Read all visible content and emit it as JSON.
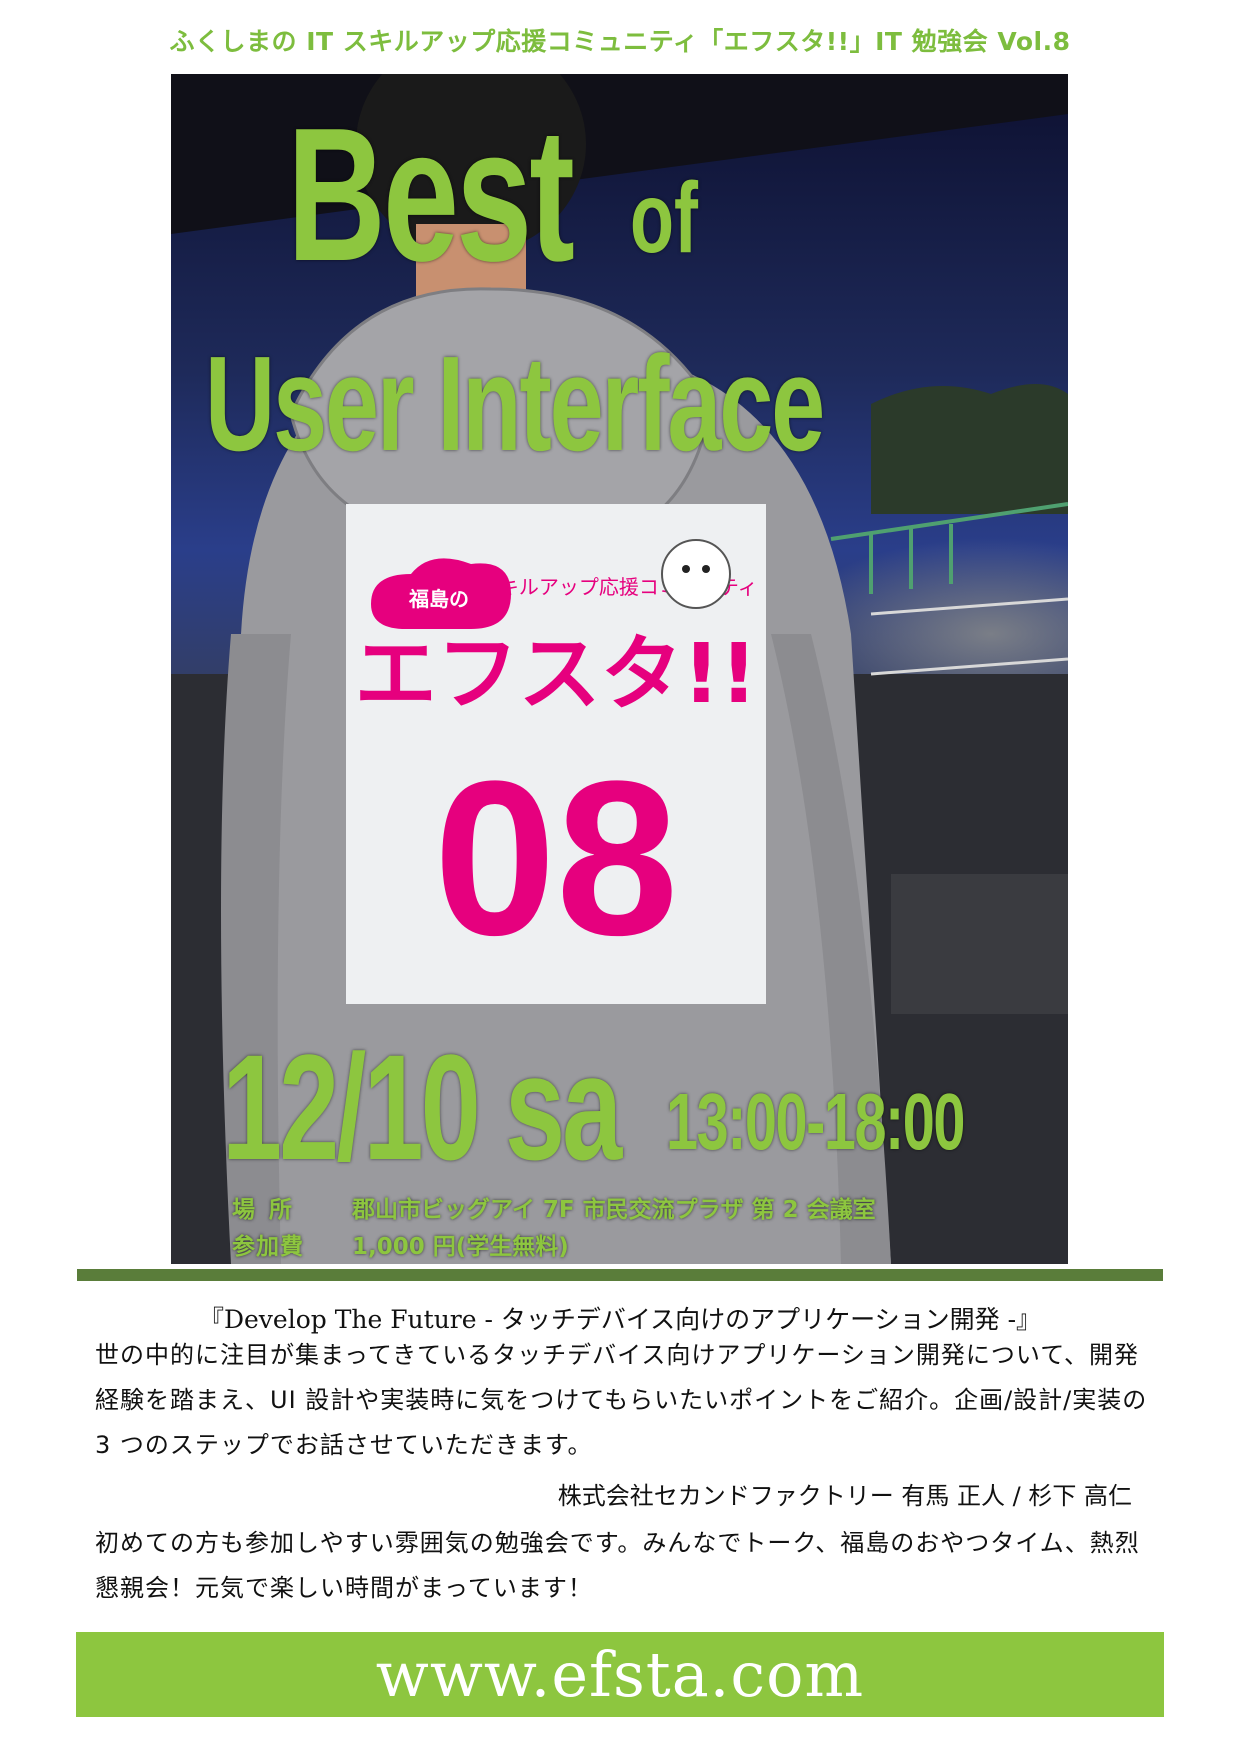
{
  "header": {
    "title": "ふくしまの IT スキルアップ応援コミュニティ「エフスタ!!」IT 勉強会 Vol.8"
  },
  "poster": {
    "headline_best": "Best",
    "headline_of": "of",
    "headline_ui": "User Interface",
    "date": "12/10 sa",
    "time": "13:00-18:00",
    "venue_label": "場所",
    "venue": "郡山市ビッグアイ 7F 市民交流プラザ 第 2 会議室",
    "fee_label": "参加費",
    "fee": "1,000 円(学生無料)"
  },
  "bib": {
    "bubble_text": "福島の",
    "tagline": "IT スキルアップ応援コミュニティ",
    "brand": "エフスタ!!",
    "number": "08"
  },
  "talk": {
    "title": "『Develop The Future - タッチデバイス向けのアプリケーション開発 -』",
    "description": "世の中的に注目が集まってきているタッチデバイス向けアプリケーション開発について、開発経験を踏まえ、UI 設計や実装時に気をつけてもらいたいポイントをご紹介。企画/設計/実装の 3 つのステップでお話させていただきます。",
    "speakers": "株式会社セカンドファクトリー 有馬 正人 / 杉下 高仁"
  },
  "footer": {
    "invitation": "初めての方も参加しやすい雰囲気の勉強会です。みんなでトーク、福島のおやつタイム、熱烈懇親会！元気で楽しい時間がまっています！",
    "url": "www.efsta.com"
  },
  "colors": {
    "accent_green": "#8dc63f",
    "title_green": "#7dbd3e",
    "rule_green": "#5a7d3a",
    "bib_pink": "#e6007e"
  }
}
